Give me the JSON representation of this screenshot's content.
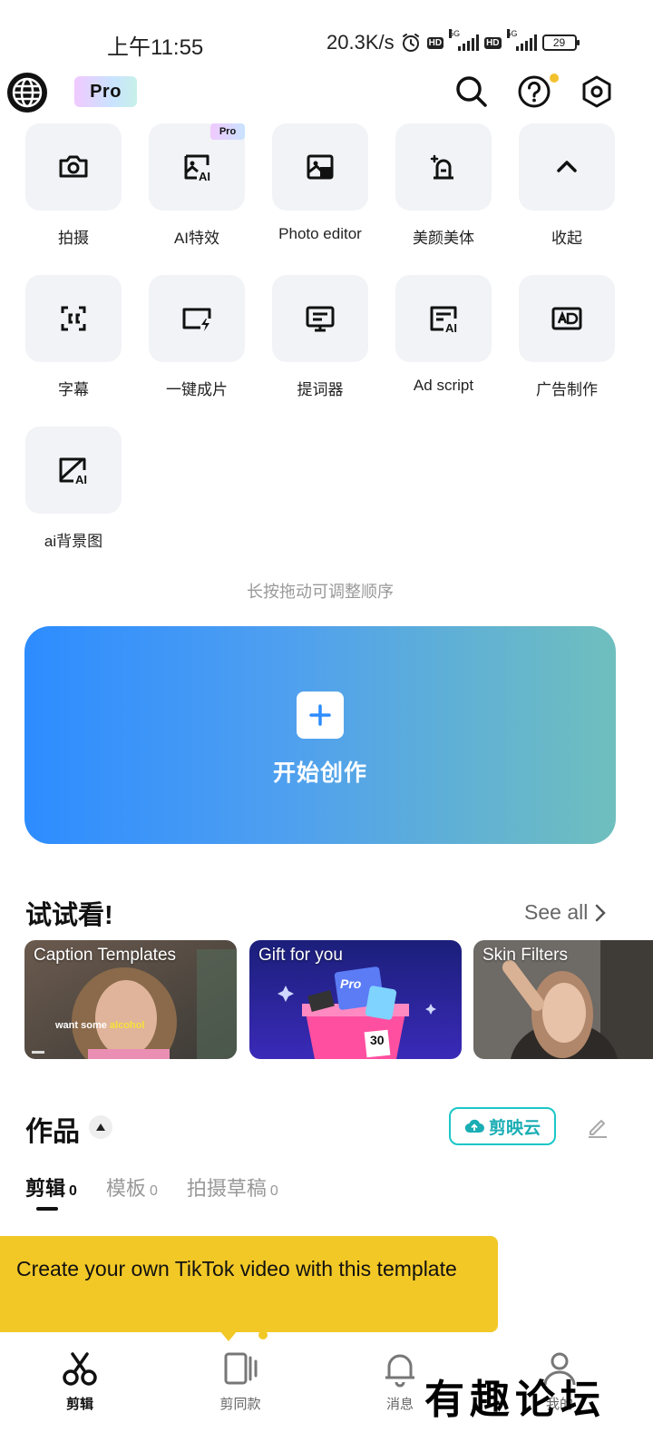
{
  "status_bar": {
    "time": "上午11:55",
    "speed": "20.3K/s",
    "network1": "5G",
    "network2": "5G",
    "hd": "HD",
    "battery": "29"
  },
  "top_bar": {
    "pro_label": "Pro",
    "icons": [
      "globe-icon",
      "search-icon",
      "help-icon",
      "settings-icon"
    ]
  },
  "tools": {
    "items": [
      {
        "label": "拍摄",
        "icon": "camera-icon"
      },
      {
        "label": "AI特效",
        "icon": "ai-image-icon",
        "badge": "Pro"
      },
      {
        "label": "Photo editor",
        "icon": "photo-edit-icon"
      },
      {
        "label": "美颜美体",
        "icon": "beauty-icon"
      },
      {
        "label": "收起",
        "icon": "chevron-up-icon"
      },
      {
        "label": "字幕",
        "icon": "caption-icon"
      },
      {
        "label": "一键成片",
        "icon": "auto-cut-icon"
      },
      {
        "label": "提词器",
        "icon": "teleprompter-icon"
      },
      {
        "label": "Ad script",
        "icon": "ad-script-icon"
      },
      {
        "label": "广告制作",
        "icon": "ad-make-icon"
      },
      {
        "label": "ai背景图",
        "icon": "ai-background-icon"
      }
    ],
    "hint": "长按拖动可调整顺序"
  },
  "start": {
    "label": "开始创作"
  },
  "try_section": {
    "title": "试试看!",
    "see_all": "See all",
    "cards": [
      {
        "title": "Caption Templates",
        "subtitle_word": "want some",
        "highlight_word": "alcohol"
      },
      {
        "title": "Gift for you",
        "badge": "Pro",
        "number": "30"
      },
      {
        "title": "Skin Filters"
      }
    ]
  },
  "works": {
    "title": "作品",
    "cloud_label": "剪映云",
    "tabs": [
      {
        "label": "剪辑",
        "count": "0"
      },
      {
        "label": "模板",
        "count": "0"
      },
      {
        "label": "拍摄草稿",
        "count": "0"
      }
    ]
  },
  "tooltip": {
    "text": "Create your own TikTok video with this template"
  },
  "bottom_nav": {
    "items": [
      {
        "label": "剪辑",
        "icon": "scissors-icon"
      },
      {
        "label": "剪同款",
        "icon": "template-icon"
      },
      {
        "label": "消息",
        "icon": "bell-icon"
      },
      {
        "label": "我的",
        "icon": "profile-icon"
      }
    ]
  },
  "watermark": "有趣论坛",
  "colors": {
    "accent_blue": "#2d8cff",
    "accent_teal": "#6fbfbe",
    "cloud_teal": "#1cc7c7",
    "tooltip_yellow": "#f2c826"
  }
}
